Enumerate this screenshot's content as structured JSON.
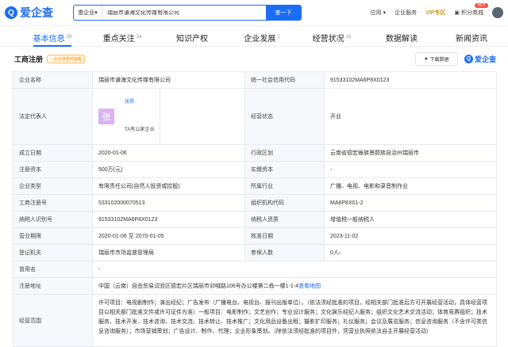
{
  "logo": {
    "mark": "Q",
    "text": "爱企查"
  },
  "search": {
    "type": "查企业",
    "query": "瑞丽市谦海文化传媒有限公司",
    "button": "查一下"
  },
  "nav": [
    "应用",
    "企业服务",
    "VIP专区",
    "积分商城"
  ],
  "hot": "HOT",
  "tabs": [
    {
      "label": "基本信息",
      "count": "39"
    },
    {
      "label": "重点关注",
      "count": "34"
    },
    {
      "label": "知识产权",
      "count": ""
    },
    {
      "label": "企业发展",
      "count": "2"
    },
    {
      "label": "经营状况",
      "count": "16"
    },
    {
      "label": "数据解读",
      "count": ""
    },
    {
      "label": "新闻资讯",
      "count": ""
    }
  ],
  "section": {
    "title": "工商注册",
    "badge": "企业变更时提醒",
    "download": "下载数据",
    "brand": "爱企查"
  },
  "rows": [
    [
      "企业名称",
      "瑞丽市谦海文化传媒有限公司",
      "统一社会信用代码",
      "91533102MA6P8X0123"
    ],
    [
      "法定代表人",
      "",
      "经营状态",
      "开业"
    ],
    [
      "成立日期",
      "2020-01-06",
      "行政区划",
      "云南省德宏傣族景颇族自治州瑞丽市"
    ],
    [
      "注册资本",
      "500万(元)",
      "实缴资本",
      "-"
    ],
    [
      "企业类型",
      "有限责任公司(自然人投资或控股)",
      "所属行业",
      "广播、电视、电影和录音制作业"
    ],
    [
      "工商注册号",
      "533102000070513",
      "组织机构代码",
      "MA6P8X01-2"
    ],
    [
      "纳税人识别号",
      "91533102MA6P8X0123",
      "纳税人资质",
      "增值税一般纳税人"
    ],
    [
      "营业期限",
      "2020-01-06 至 2070-01-05",
      "核准日期",
      "2023-11-02"
    ],
    [
      "登记机关",
      "瑞丽市市场监督管理局",
      "参保人数",
      "0人"
    ],
    [
      "曾用名",
      "-",
      "",
      ""
    ]
  ],
  "person": {
    "avatar": "张",
    "name": "张扬",
    "sub": "TA有11家企业"
  },
  "address": {
    "label": "注册地址",
    "value": "中国（云南）自由贸易试验区德宏片区瑞丽市卯喊路106号办公楼第二栋一楼1-1-4",
    "map": "查看地图"
  },
  "scope": {
    "label": "经营范围",
    "value": "许可项目：电视剧制作；演出经纪；广告发布（广播电台、电视台、报刊出版单位）。（依法须经批准的项目，经相关部门批准后方可开展经营活动，具体经营项目以相关部门批准文件或许可证件为准）一般项目：电影制作；文艺创作；专业设计服务；文化娱乐经纪人服务；组织文化艺术交流活动；体育竞赛组织；技术服务、技术开发、技术咨询、技术交流、技术转让、技术推广；文化用品设备出租；摄影扩印服务；礼仪服务；会议及展览服务；信息咨询服务（不含许可类信息咨询服务）；市场营销策划；广告设计、制作、代理；企业形象策划。（除依法须经批准的项目外，凭营业执照依法自主开展经营活动）"
  }
}
